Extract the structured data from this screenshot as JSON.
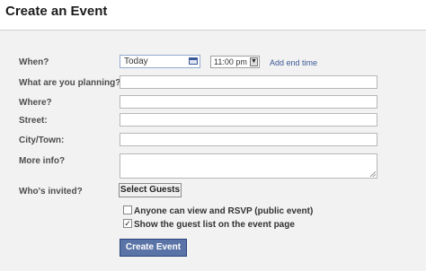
{
  "header": {
    "title": "Create an Event"
  },
  "form": {
    "labels": {
      "when": "When?",
      "planning": "What are you planning?",
      "where": "Where?",
      "street": "Street:",
      "city": "City/Town:",
      "more_info": "More info?",
      "invited": "Who's invited?"
    },
    "date_value": "Today",
    "time_value": "11:00 pm",
    "add_end_time": "Add end time",
    "select_guests": "Select Guests",
    "public_event": {
      "label": "Anyone can view and RSVP (public event)",
      "checked": false
    },
    "show_guest_list": {
      "label": "Show the guest list on the event page",
      "checked": true
    },
    "submit": "Create Event"
  }
}
